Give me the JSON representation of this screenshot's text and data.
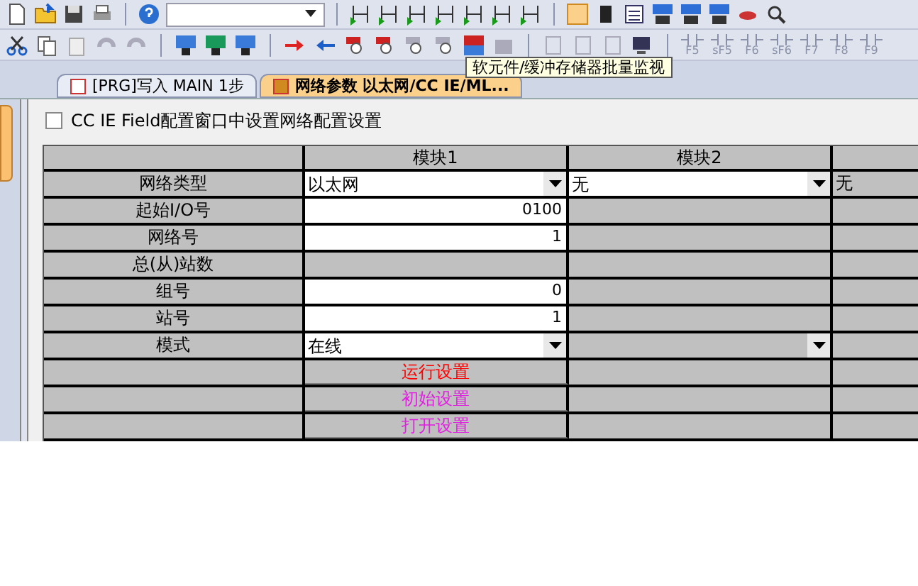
{
  "toolbar": {
    "fkeys": [
      "F5",
      "sF5",
      "F6",
      "sF6",
      "F7",
      "F8",
      "F9"
    ]
  },
  "tooltip": "软元件/缓冲存储器批量监视",
  "tabs": [
    {
      "label": "[PRG]写入 MAIN 1步",
      "selected": false
    },
    {
      "label": "网络参数 以太网/CC IE/ML...",
      "selected": true
    }
  ],
  "checkbox": {
    "label": "CC IE Field配置窗口中设置网络配置设置",
    "checked": false
  },
  "table": {
    "columns": [
      "模块1",
      "模块2"
    ],
    "rows": [
      {
        "label": "网络类型",
        "kind": "select",
        "cells": [
          {
            "value": "以太网",
            "enabled": true
          },
          {
            "value": "无",
            "enabled": true
          }
        ],
        "extra": "无"
      },
      {
        "label": "起始I/O号",
        "kind": "input",
        "cells": [
          {
            "value": "0100",
            "enabled": true
          },
          {
            "enabled": false
          }
        ]
      },
      {
        "label": "网络号",
        "kind": "input",
        "cells": [
          {
            "value": "1",
            "enabled": true
          },
          {
            "enabled": false
          }
        ]
      },
      {
        "label": "总(从)站数",
        "kind": "input",
        "cells": [
          {
            "enabled": false
          },
          {
            "enabled": false
          }
        ]
      },
      {
        "label": "组号",
        "kind": "input",
        "cells": [
          {
            "value": "0",
            "enabled": true
          },
          {
            "enabled": false
          }
        ]
      },
      {
        "label": "站号",
        "kind": "input",
        "cells": [
          {
            "value": "1",
            "enabled": true
          },
          {
            "enabled": false
          }
        ]
      },
      {
        "label": "模式",
        "kind": "select",
        "cells": [
          {
            "value": "在线",
            "enabled": true
          },
          {
            "enabled": false
          }
        ]
      },
      {
        "kind": "button",
        "cells": [
          {
            "value": "运行设置",
            "color": "#ff0000"
          },
          {}
        ]
      },
      {
        "kind": "button",
        "cells": [
          {
            "value": "初始设置",
            "color": "#e020e0"
          },
          {}
        ]
      },
      {
        "kind": "button",
        "cells": [
          {
            "value": "打开设置",
            "color": "#e020e0"
          },
          {}
        ]
      }
    ]
  }
}
